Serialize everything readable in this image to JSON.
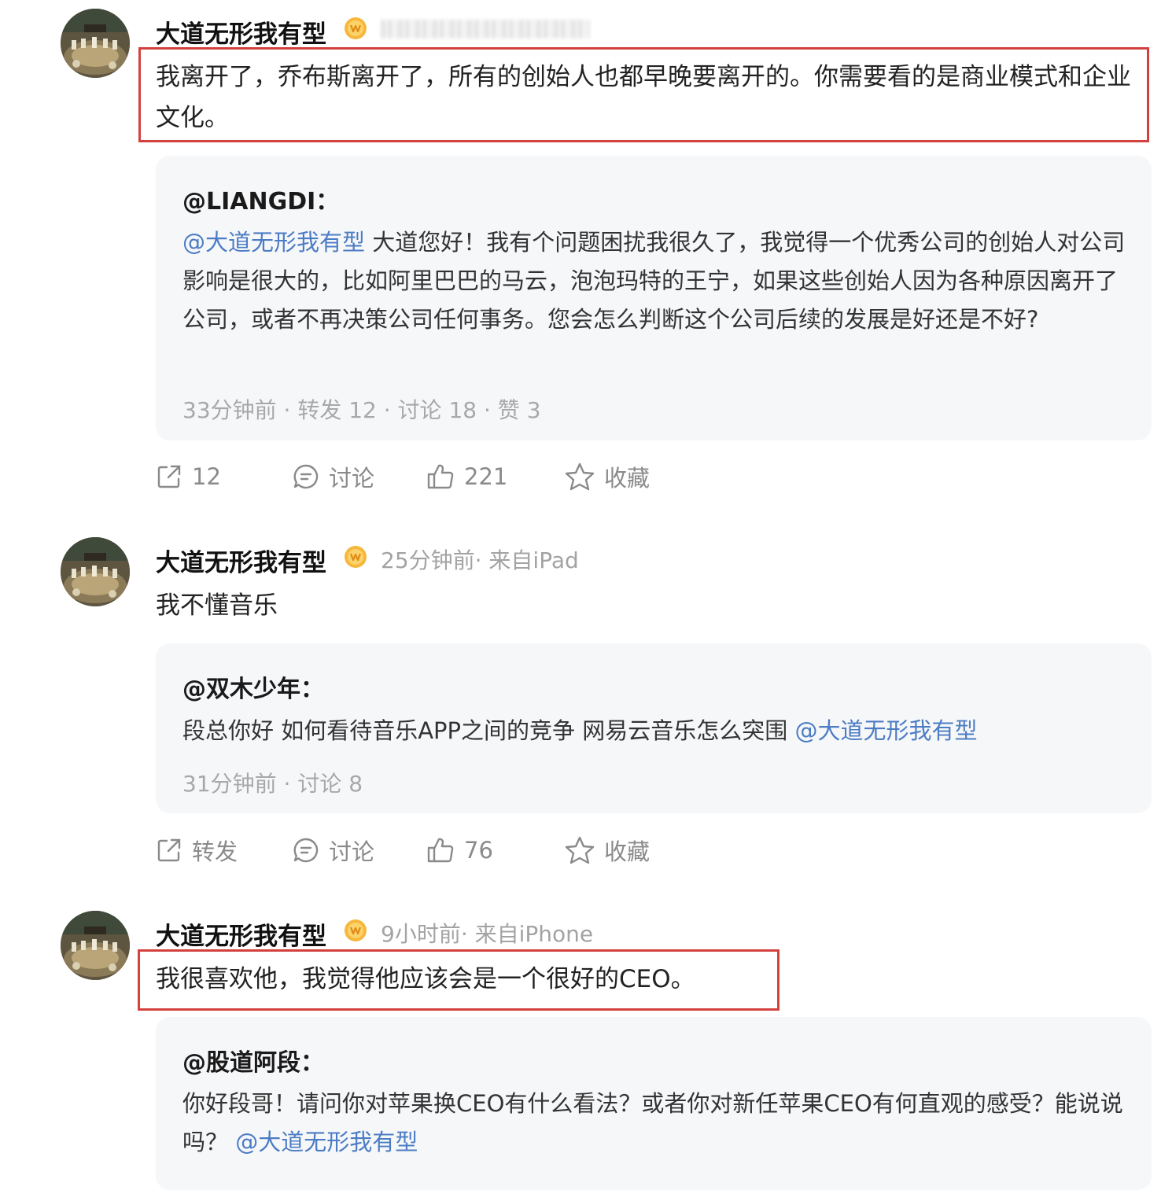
{
  "posts": [
    {
      "author": "大道无形我有型",
      "body": "我离开了，乔布斯离开了，所有的创始人也都早晚要离开的。你需要看的是商业模式和企业文化。",
      "quote": {
        "user": "@LIANGDI：",
        "mention": "@大道无形我有型",
        "text": " 大道您好！我有个问题困扰我很久了，我觉得一个优秀公司的创始人对公司影响是很大的，比如阿里巴巴的马云，泡泡玛特的王宁，如果这些创始人因为各种原因离开了公司，或者不再决策公司任何事务。您会怎么判断这个公司后续的发展是好还是不好?",
        "meta": "33分钟前  · 转发 12 · 讨论 18 · 赞 3"
      },
      "actions": {
        "share": "12",
        "comment": "讨论",
        "like": "221",
        "fav": "收藏"
      }
    },
    {
      "author": "大道无形我有型",
      "meta": "25分钟前· 来自iPad",
      "body": "我不懂音乐",
      "quote": {
        "user": "@双木少年：",
        "text": "段总你好 如何看待音乐APP之间的竞争 网易云音乐怎么突围 ",
        "mention": "@大道无形我有型",
        "meta": "31分钟前  · 讨论 8"
      },
      "actions": {
        "share": "转发",
        "comment": "讨论",
        "like": "76",
        "fav": "收藏"
      }
    },
    {
      "author": "大道无形我有型",
      "meta": "9小时前· 来自iPhone",
      "body": "我很喜欢他，我觉得他应该会是一个很好的CEO。",
      "quote": {
        "user": "@股道阿段：",
        "text": "你好段哥！请问你对苹果换CEO有什么看法？或者你对新任苹果CEO有何直观的感受？能说说吗？ ",
        "mention": "@大道无形我有型"
      }
    }
  ],
  "colors": {
    "highlight": "#d2413e",
    "mention": "#4c7cc4",
    "meta": "#a3a3a3",
    "quote_bg": "#f6f7f9"
  },
  "icons": [
    "avatar",
    "vip-badge-icon",
    "share-icon",
    "comment-icon",
    "like-icon",
    "star-icon"
  ]
}
